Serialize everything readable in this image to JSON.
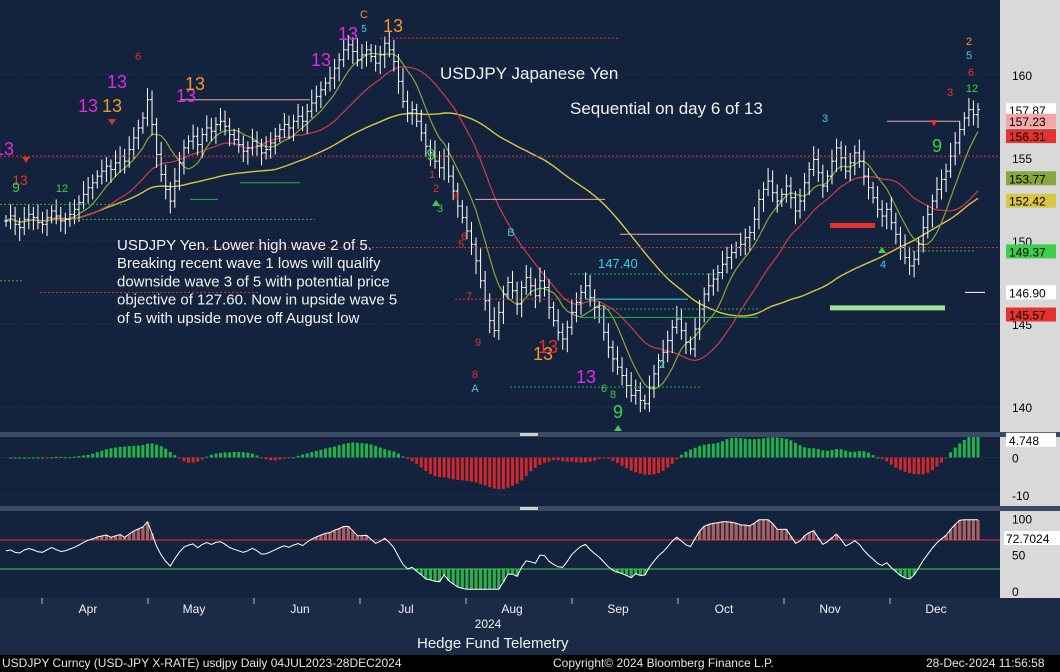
{
  "colors": {
    "bg": "#1c2b45",
    "panel_bg": "#13233d",
    "axis_bg": "#d9d9d9",
    "candle": "#ffffff",
    "sma_fast": "#8aa63a",
    "sma_mid": "#d23a4a",
    "sma_slow": "#d9c646",
    "pos_hist": "#22b24a",
    "neg_hist": "#d0282c",
    "rsi_line": "#ffffff",
    "green_text": "#3ad04a",
    "red_text": "#e8302e",
    "magenta_text": "#e02ae0",
    "orange_text": "#f0962a",
    "cyan_text": "#3ad0e6"
  },
  "chart_data": [
    {
      "type": "candlestick",
      "title": "USDJPY Japanese Yen",
      "subtitle": "Sequential on day 6 of 13",
      "annotation": "USDJPY Yen.  Lower high wave 2 of 5. Breaking recent wave 1 lows will qualify downside wave 3 of 5 with potential price objective of 127.60.  Now in upside wave 5 of 5 with upside move off August low",
      "annotation_lines": [
        "USDJPY Yen.  Lower high wave 2 of 5.",
        "Breaking recent wave 1 lows will qualify",
        "downside wave 3 of 5 with potential price",
        "objective of 127.60.  Now in upside wave 5",
        "of 5 with upside move off August low"
      ],
      "level_label": "147.40",
      "ylim": [
        138.5,
        164.5
      ],
      "y_ticks": [
        "140",
        "145",
        "150",
        "155",
        "160"
      ],
      "y_tick_values": [
        140,
        145,
        150,
        155,
        160
      ],
      "x_months": [
        "Apr",
        "May",
        "Jun",
        "Jul",
        "Aug",
        "Sep",
        "Oct",
        "Nov",
        "Dec"
      ],
      "x_year": "2024",
      "price_tags": [
        {
          "text": "157.87",
          "value": 157.87,
          "bg": "#ffffff",
          "fg": "#000000"
        },
        {
          "text": "157.23",
          "value": 157.23,
          "bg": "#f3a6a6",
          "fg": "#000000"
        },
        {
          "text": "156.31",
          "value": 156.31,
          "bg": "#e8302e",
          "fg": "#000000"
        },
        {
          "text": "153.77",
          "value": 153.77,
          "bg": "#8aa63a",
          "fg": "#000000"
        },
        {
          "text": "152.42",
          "value": 152.42,
          "bg": "#d9c646",
          "fg": "#000000"
        },
        {
          "text": "149.37",
          "value": 149.37,
          "bg": "#3ad04a",
          "fg": "#000000"
        },
        {
          "text": "146.90",
          "value": 146.9,
          "bg": "#ffffff",
          "fg": "#000000"
        },
        {
          "text": "145.57",
          "value": 145.57,
          "bg": "#e8302e",
          "fg": "#000000"
        }
      ],
      "ohlc_close": [
        151.2,
        151.5,
        151.0,
        150.8,
        151.3,
        151.6,
        151.4,
        151.1,
        151.0,
        151.4,
        151.8,
        151.5,
        151.2,
        151.3,
        151.6,
        151.9,
        152.3,
        152.8,
        153.2,
        153.5,
        153.9,
        154.2,
        154.5,
        154.3,
        154.7,
        155.1,
        154.8,
        155.5,
        156.2,
        156.8,
        157.4,
        158.5,
        157.0,
        155.2,
        154.0,
        153.1,
        152.4,
        153.6,
        154.7,
        155.6,
        156.0,
        156.3,
        155.8,
        156.4,
        156.8,
        156.6,
        157.0,
        157.2,
        156.9,
        156.4,
        156.1,
        155.8,
        155.4,
        155.6,
        156.0,
        155.7,
        155.3,
        155.5,
        155.9,
        156.3,
        156.7,
        157.0,
        156.8,
        157.2,
        157.5,
        157.2,
        157.8,
        158.3,
        158.7,
        159.1,
        159.5,
        159.8,
        160.4,
        160.9,
        161.5,
        161.8,
        161.4,
        160.9,
        161.2,
        161.5,
        161.1,
        160.7,
        161.2,
        161.9,
        161.5,
        160.8,
        159.6,
        158.4,
        157.7,
        157.9,
        157.2,
        156.5,
        155.7,
        155.3,
        154.8,
        154.4,
        155.1,
        153.9,
        153.0,
        152.1,
        151.4,
        150.6,
        149.8,
        148.8,
        147.6,
        146.4,
        145.2,
        144.6,
        145.7,
        146.8,
        147.5,
        147.0,
        146.2,
        147.2,
        147.8,
        147.3,
        146.7,
        147.6,
        147.2,
        146.0,
        145.2,
        144.5,
        144.1,
        144.8,
        145.7,
        146.3,
        146.9,
        147.3,
        146.6,
        146.0,
        145.4,
        144.5,
        143.6,
        142.9,
        142.4,
        141.9,
        141.3,
        140.7,
        141.0,
        140.4,
        140.2,
        141.2,
        142.0,
        142.8,
        143.3,
        144.0,
        144.8,
        145.3,
        144.6,
        143.9,
        143.5,
        144.7,
        145.9,
        146.8,
        147.3,
        147.7,
        148.1,
        148.6,
        149.0,
        149.3,
        149.6,
        149.8,
        150.2,
        150.5,
        151.3,
        152.5,
        153.1,
        153.6,
        152.9,
        152.4,
        152.8,
        153.3,
        152.6,
        151.8,
        152.4,
        153.5,
        154.3,
        154.9,
        154.1,
        153.3,
        153.9,
        154.8,
        155.6,
        155.0,
        154.2,
        154.7,
        155.3,
        154.8,
        153.9,
        153.2,
        152.6,
        151.9,
        151.5,
        151.9,
        151.1,
        150.4,
        149.6,
        149.0,
        148.5,
        148.9,
        149.8,
        150.8,
        151.6,
        152.4,
        153.1,
        153.7,
        154.2,
        155.1,
        155.9,
        156.7,
        157.4,
        157.9,
        157.6,
        157.9
      ]
    },
    {
      "type": "bar",
      "title": "",
      "y_ticks": [
        "0",
        "-10"
      ],
      "y_tick_values": [
        0,
        -10
      ],
      "ylim": [
        -13,
        5.5
      ],
      "last_value_tag": "4.748",
      "last_value": 4.748
    },
    {
      "type": "line",
      "title": "",
      "y_ticks": [
        "100",
        "50",
        "0"
      ],
      "y_tick_values": [
        100,
        50,
        0
      ],
      "ylim": [
        -10,
        110
      ],
      "upper_band": 70,
      "lower_band": 30,
      "last_value_tag": "72.7024",
      "last_value": 72.7024
    }
  ],
  "footer": {
    "center": "Hedge Fund Telemetry",
    "ticker": "USDJPY Curncy (USD-JPY X-RATE) usdjpy  Daily 04JUL2023-28DEC2024",
    "copyright": "Copyright© 2024 Bloomberg Finance L.P.",
    "timestamp": "28-Dec-2024 11:56:58"
  }
}
